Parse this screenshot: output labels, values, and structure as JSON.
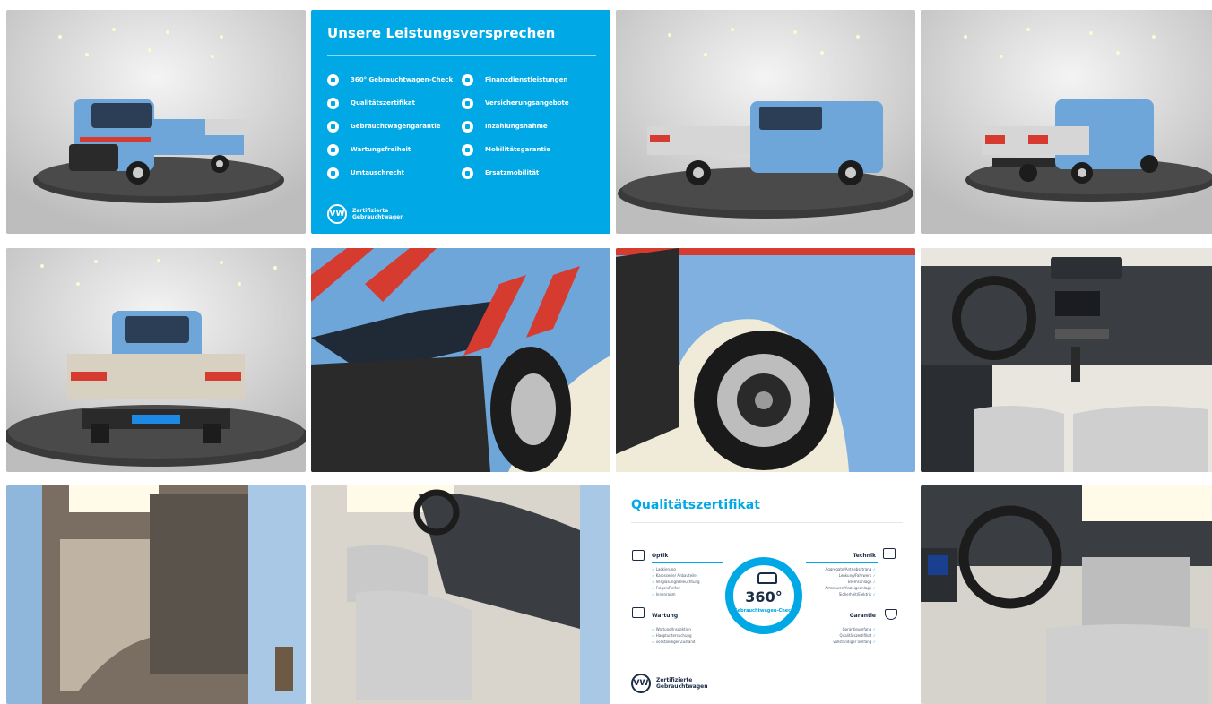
{
  "promo": {
    "title": "Unsere Leistungsversprechen",
    "left_items": [
      {
        "label": "360° Gebrauchtwagen-Check",
        "icon": "check-icon"
      },
      {
        "label": "Qualitätszertifikat",
        "icon": "certificate-icon"
      },
      {
        "label": "Gebrauchtwagengarantie",
        "icon": "shield-icon"
      },
      {
        "label": "Wartungsfreiheit",
        "icon": "wrench-icon"
      },
      {
        "label": "Umtauschrecht",
        "icon": "exchange-icon"
      }
    ],
    "right_items": [
      {
        "label": "Finanzdienstleistungen",
        "icon": "finance-icon"
      },
      {
        "label": "Versicherungsangebote",
        "icon": "umbrella-icon"
      },
      {
        "label": "Inzahlungsnahme",
        "icon": "tradein-icon"
      },
      {
        "label": "Mobilitätsgarantie",
        "icon": "car-icon"
      },
      {
        "label": "Ersatzmobilität",
        "icon": "key-icon"
      }
    ],
    "footer_line1": "Zertifizierte",
    "footer_line2": "Gebrauchtwagen"
  },
  "cert": {
    "title": "Qualitätszertifikat",
    "optik": {
      "heading": "Optik",
      "items": [
        "Lackierung",
        "Karosserie/ Anbauteile",
        "Verglasung/Beleuchtung",
        "Felgen/Reifen",
        "Innenraum"
      ]
    },
    "wartung": {
      "heading": "Wartung",
      "items": [
        "Wartung/Inspektion",
        "Hauptuntersuchung",
        "vollständiger Zustand"
      ]
    },
    "technik": {
      "heading": "Technik",
      "items": [
        "Aggregate/Antriebsstrang",
        "Lenkung/Fahrwerk",
        "Bremsanlage",
        "Armaturen/Anzeigeanlage",
        "Sicherheit/Elektrik"
      ]
    },
    "garantie": {
      "heading": "Garantie",
      "items": [
        "Garantieumfang",
        "Qualitätszertifikat",
        "vollständiger Umfang"
      ]
    },
    "badge_number": "360°",
    "badge_sub": "Gebrauchtwagen-Check",
    "footer_line1": "Zertifizierte",
    "footer_line2": "Gebrauchtwagen"
  },
  "colors": {
    "vw_blue": "#00a8e6",
    "truck_blue": "#6fa6d9",
    "navy": "#1a2b45"
  }
}
